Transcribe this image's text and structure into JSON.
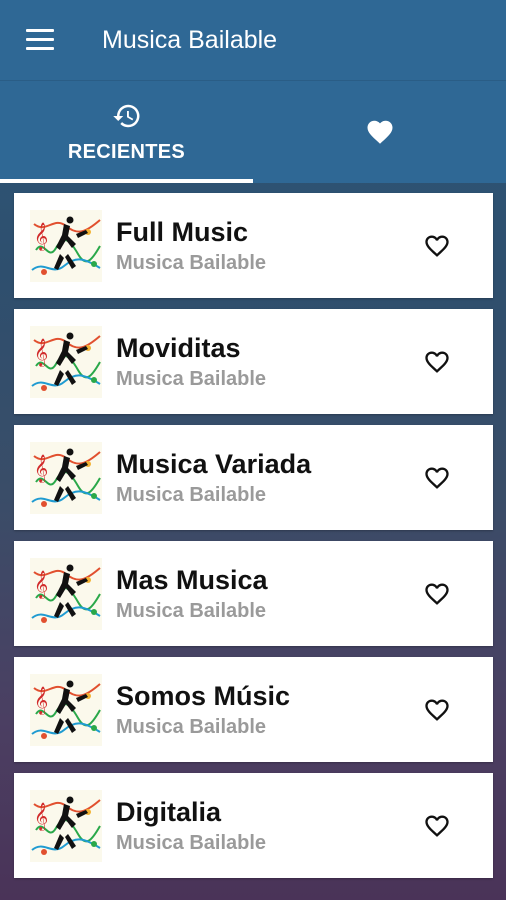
{
  "app": {
    "title": "Musica Bailable"
  },
  "tabs": [
    {
      "label": "RECIENTES",
      "icon": "history-icon",
      "active": true
    },
    {
      "label": "",
      "icon": "heart-icon",
      "active": false
    }
  ],
  "colors": {
    "appbar": "#2f6895",
    "indicator": "#ffffff",
    "title_text": "#111111",
    "subtitle_text": "#9a9a9a"
  },
  "items": [
    {
      "title": "Full Music",
      "subtitle": "Musica Bailable",
      "favorite": false
    },
    {
      "title": "Moviditas",
      "subtitle": "Musica Bailable",
      "favorite": false
    },
    {
      "title": "Musica Variada",
      "subtitle": "Musica Bailable",
      "favorite": false
    },
    {
      "title": "Mas Musica",
      "subtitle": "Musica Bailable",
      "favorite": false
    },
    {
      "title": "Somos Músic",
      "subtitle": "Musica Bailable",
      "favorite": false
    },
    {
      "title": "Digitalia",
      "subtitle": "Musica Bailable",
      "favorite": false
    }
  ]
}
